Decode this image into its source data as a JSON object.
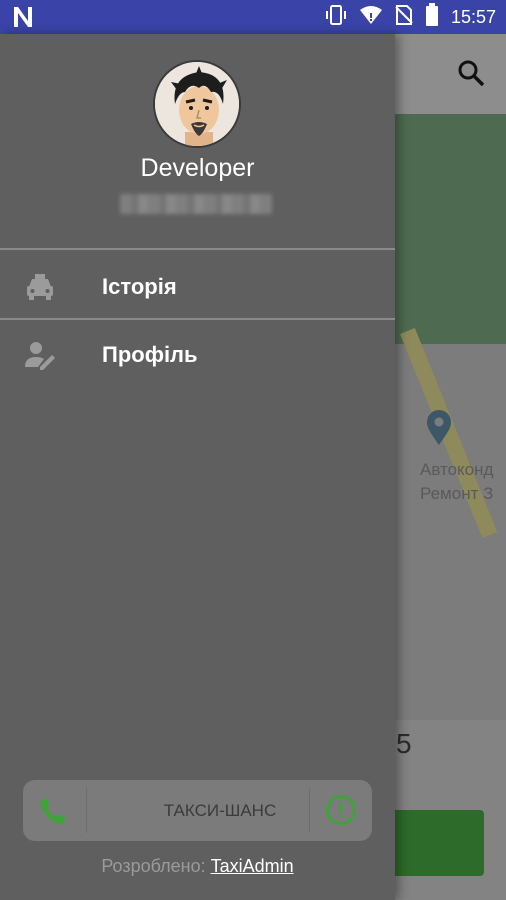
{
  "status_bar": {
    "left_icon": "n-icon",
    "time": "15:57",
    "icons": [
      "vibrate-icon",
      "wifi-icon",
      "no-sim-icon",
      "battery-icon"
    ]
  },
  "map": {
    "poi_line1": "Автоконд",
    "poi_line2": "Ремонт З",
    "partial_number": "5"
  },
  "drawer": {
    "username": "Developer",
    "menu": [
      {
        "label": "Історія",
        "icon": "taxi-icon"
      },
      {
        "label": "Профіль",
        "icon": "edit-profile-icon"
      }
    ],
    "footer": {
      "service_name": "ТАКСИ-ШАНС",
      "credit_prefix": "Розроблено:",
      "credit_link": "TaxiAdmin"
    }
  },
  "colors": {
    "status_bar": "#3a44a8",
    "drawer_bg": "#5f5f5f",
    "accent_green": "#3fa33a"
  }
}
